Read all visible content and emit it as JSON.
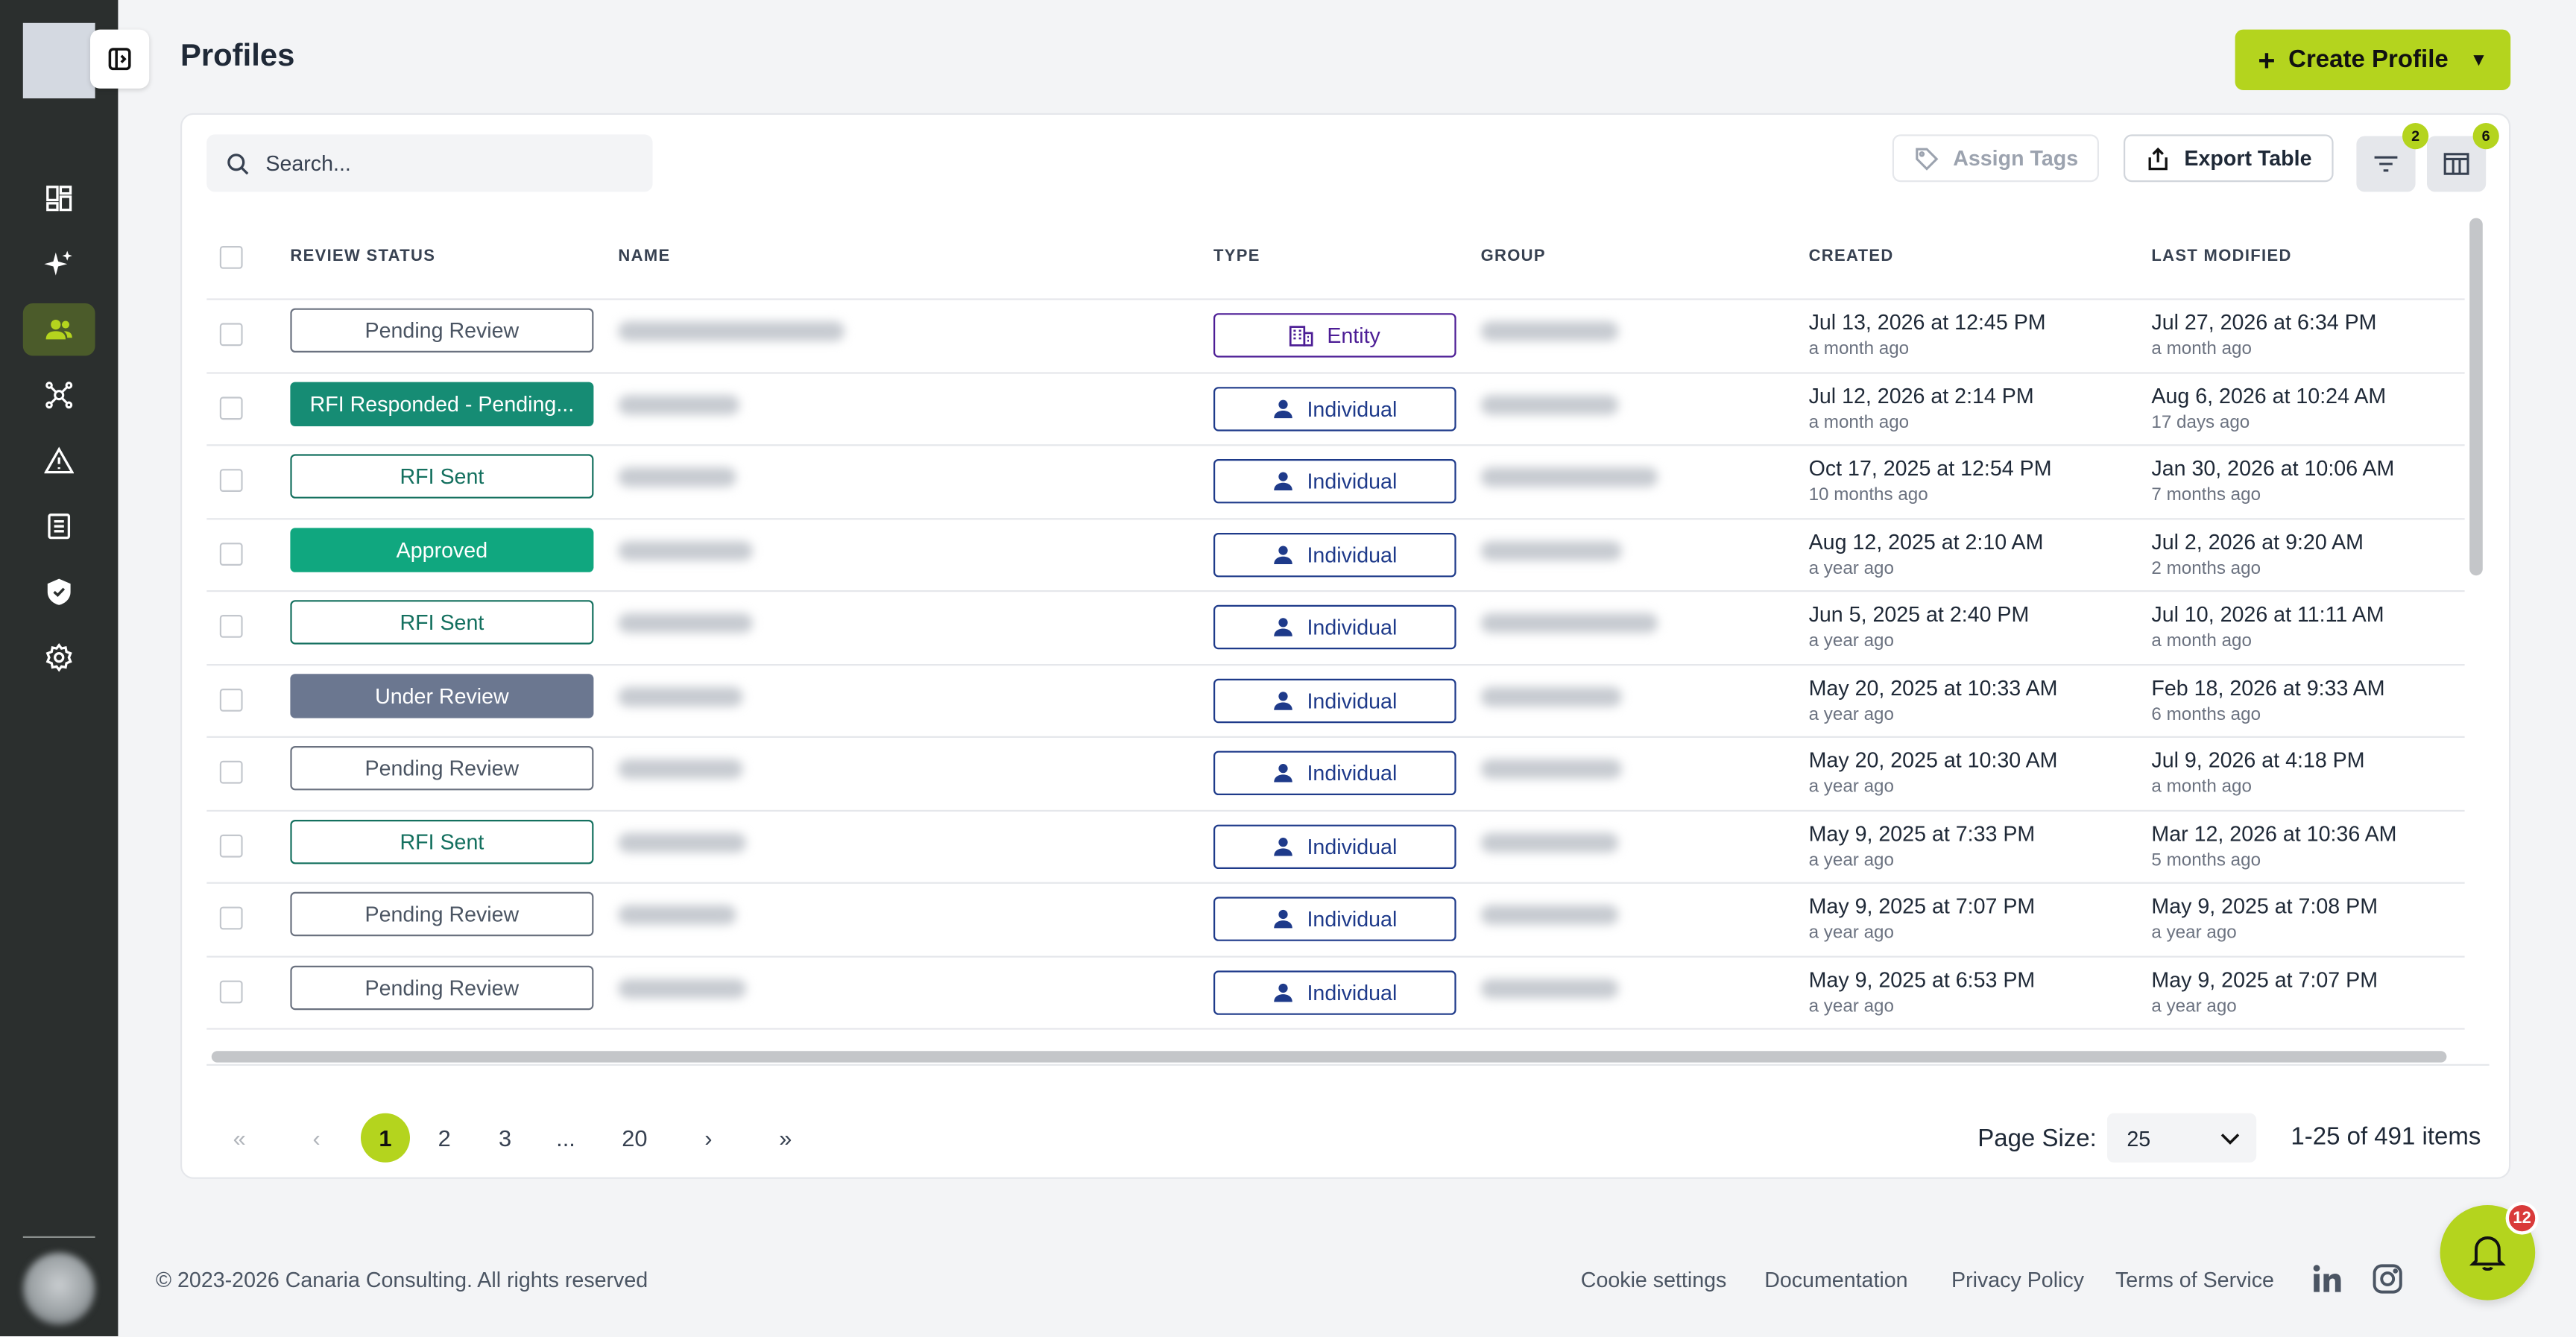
{
  "header": {
    "title": "Profiles",
    "create_label": "Create Profile"
  },
  "toolbar": {
    "search_placeholder": "Search...",
    "assign_tags_label": "Assign Tags",
    "export_label": "Export Table",
    "filter_count": "2",
    "columns_count": "6"
  },
  "table": {
    "columns": [
      "REVIEW STATUS",
      "NAME",
      "TYPE",
      "GROUP",
      "CREATED",
      "LAST MODIFIED"
    ],
    "rows": [
      {
        "status": "Pending Review",
        "type": "Entity",
        "created": "Jul 13, 2026 at 12:45 PM",
        "created_rel": "a month ago",
        "modified": "Jul 27, 2026 at 6:34 PM",
        "modified_rel": "a month ago"
      },
      {
        "status": "RFI Responded - Pending...",
        "type": "Individual",
        "created": "Jul 12, 2026 at 2:14 PM",
        "created_rel": "a month ago",
        "modified": "Aug 6, 2026 at 10:24 AM",
        "modified_rel": "17 days ago"
      },
      {
        "status": "RFI Sent",
        "type": "Individual",
        "created": "Oct 17, 2025 at 12:54 PM",
        "created_rel": "10 months ago",
        "modified": "Jan 30, 2026 at 10:06 AM",
        "modified_rel": "7 months ago"
      },
      {
        "status": "Approved",
        "type": "Individual",
        "created": "Aug 12, 2025 at 2:10 AM",
        "created_rel": "a year ago",
        "modified": "Jul 2, 2026 at 9:20 AM",
        "modified_rel": "2 months ago"
      },
      {
        "status": "RFI Sent",
        "type": "Individual",
        "created": "Jun 5, 2025 at 2:40 PM",
        "created_rel": "a year ago",
        "modified": "Jul 10, 2026 at 11:11 AM",
        "modified_rel": "a month ago"
      },
      {
        "status": "Under Review",
        "type": "Individual",
        "created": "May 20, 2025 at 10:33 AM",
        "created_rel": "a year ago",
        "modified": "Feb 18, 2026 at 9:33 AM",
        "modified_rel": "6 months ago"
      },
      {
        "status": "Pending Review",
        "type": "Individual",
        "created": "May 20, 2025 at 10:30 AM",
        "created_rel": "a year ago",
        "modified": "Jul 9, 2026 at 4:18 PM",
        "modified_rel": "a month ago"
      },
      {
        "status": "RFI Sent",
        "type": "Individual",
        "created": "May 9, 2025 at 7:33 PM",
        "created_rel": "a year ago",
        "modified": "Mar 12, 2026 at 10:36 AM",
        "modified_rel": "5 months ago"
      },
      {
        "status": "Pending Review",
        "type": "Individual",
        "created": "May 9, 2025 at 7:07 PM",
        "created_rel": "a year ago",
        "modified": "May 9, 2025 at 7:08 PM",
        "modified_rel": "a year ago"
      },
      {
        "status": "Pending Review",
        "type": "Individual",
        "created": "May 9, 2025 at 6:53 PM",
        "created_rel": "a year ago",
        "modified": "May 9, 2025 at 7:07 PM",
        "modified_rel": "a year ago"
      }
    ]
  },
  "pagination": {
    "pages": [
      "1",
      "2",
      "3",
      "...",
      "20"
    ],
    "page_size_label": "Page Size:",
    "page_size": "25",
    "count": "1-25 of 491 items"
  },
  "footer": {
    "copyright": "© 2023-2026 Canaria Consulting. All rights reserved",
    "links": [
      "Cookie settings",
      "Documentation",
      "Privacy Policy",
      "Terms of Service"
    ]
  },
  "notifications": {
    "count": "12"
  },
  "colors": {
    "accent": "#b4d41e",
    "sidebar": "#2b2f2e"
  }
}
